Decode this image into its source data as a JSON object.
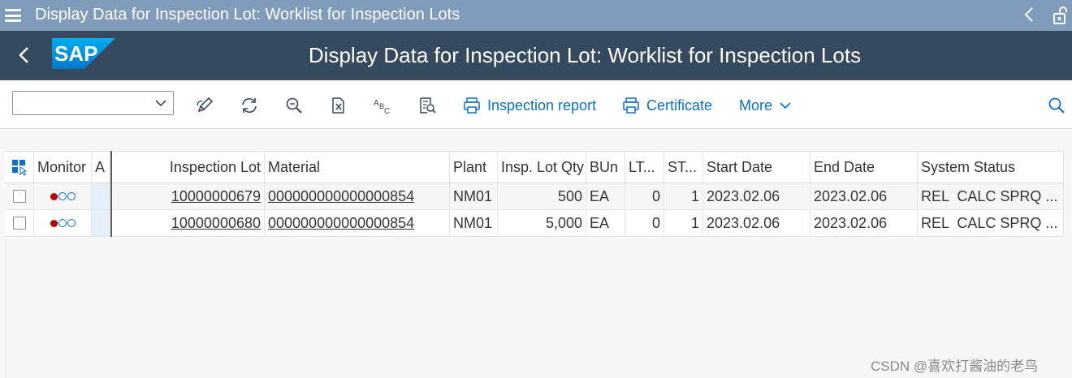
{
  "window": {
    "title": "Display Data for Inspection Lot: Worklist for Inspection Lots"
  },
  "shell": {
    "logo_text": "SAP",
    "app_title": "Display Data for Inspection Lot: Worklist for Inspection Lots"
  },
  "toolbar": {
    "variant_value": "",
    "icons": [
      "edit-icon",
      "refresh-icon",
      "zoom-icon",
      "export-icon",
      "spell-abc-icon",
      "find-icon"
    ],
    "inspection_report_label": "Inspection report",
    "certificate_label": "Certificate",
    "more_label": "More"
  },
  "table": {
    "headers": {
      "monitor": "Monitor",
      "attention": "A",
      "inspection_lot": "Inspection Lot",
      "material": "Material",
      "plant": "Plant",
      "qty": "Insp. Lot Qty",
      "bun": "BUn",
      "lt": "LT...",
      "st": "ST...",
      "start_date": "Start Date",
      "end_date": "End Date",
      "system_status": "System Status"
    },
    "rows": [
      {
        "inspection_lot": "10000000679",
        "material": "000000000000000854",
        "plant": "NM01",
        "qty": "500",
        "bun": "EA",
        "lt": "0",
        "st": "1",
        "start_date": "2023.02.06",
        "end_date": "2023.02.06",
        "system_status": "REL  CALC SPRQ ..."
      },
      {
        "inspection_lot": "10000000680",
        "material": "000000000000000854",
        "plant": "NM01",
        "qty": "5,000",
        "bun": "EA",
        "lt": "0",
        "st": "1",
        "start_date": "2023.02.06",
        "end_date": "2023.02.06",
        "system_status": "REL  CALC SPRQ ..."
      }
    ]
  },
  "watermark": "CSDN @喜欢打酱油的老鸟",
  "colors": {
    "title_bar": "#7f9cba",
    "shell_bar": "#354a5f",
    "link_blue": "#0a6ed1",
    "status_red": "#bb0000"
  }
}
